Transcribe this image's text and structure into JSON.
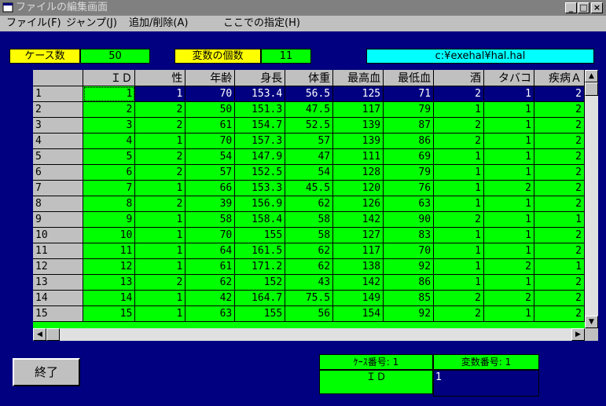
{
  "window": {
    "title": "ファイルの編集画面",
    "min_glyph": "_",
    "max_glyph": "□",
    "close_glyph": "×"
  },
  "menu": [
    "ファイル(F)",
    "ジャンプ(J)",
    "追加/削除(A)",
    "ここでの指定(H)"
  ],
  "info": {
    "case_count_label": "ケース数",
    "case_count_value": "50",
    "var_count_label": "変数の個数",
    "var_count_value": "11",
    "file_path": "c:¥exehal¥hal.hal"
  },
  "grid": {
    "columns": [
      "ＩＤ",
      "性",
      "年齢",
      "身長",
      "体重",
      "最高血",
      "最低血",
      "酒",
      "タバコ",
      "疾病Ａ"
    ],
    "rows": [
      {
        "n": "1",
        "cells": [
          "1",
          "1",
          "70",
          "153.4",
          "56.5",
          "125",
          "71",
          "2",
          "1",
          "2"
        ]
      },
      {
        "n": "2",
        "cells": [
          "2",
          "2",
          "50",
          "151.3",
          "47.5",
          "117",
          "79",
          "1",
          "1",
          "2"
        ]
      },
      {
        "n": "3",
        "cells": [
          "3",
          "2",
          "61",
          "154.7",
          "52.5",
          "139",
          "87",
          "2",
          "1",
          "2"
        ]
      },
      {
        "n": "4",
        "cells": [
          "4",
          "1",
          "70",
          "157.3",
          "57",
          "139",
          "86",
          "2",
          "1",
          "2"
        ]
      },
      {
        "n": "5",
        "cells": [
          "5",
          "2",
          "54",
          "147.9",
          "47",
          "111",
          "69",
          "1",
          "1",
          "2"
        ]
      },
      {
        "n": "6",
        "cells": [
          "6",
          "2",
          "57",
          "152.5",
          "54",
          "128",
          "79",
          "1",
          "1",
          "2"
        ]
      },
      {
        "n": "7",
        "cells": [
          "7",
          "1",
          "66",
          "153.3",
          "45.5",
          "120",
          "76",
          "1",
          "2",
          "2"
        ]
      },
      {
        "n": "8",
        "cells": [
          "8",
          "2",
          "39",
          "156.9",
          "62",
          "126",
          "63",
          "1",
          "1",
          "2"
        ]
      },
      {
        "n": "9",
        "cells": [
          "9",
          "1",
          "58",
          "158.4",
          "58",
          "142",
          "90",
          "2",
          "1",
          "1"
        ]
      },
      {
        "n": "10",
        "cells": [
          "10",
          "1",
          "70",
          "155",
          "58",
          "127",
          "83",
          "1",
          "1",
          "2"
        ]
      },
      {
        "n": "11",
        "cells": [
          "11",
          "1",
          "64",
          "161.5",
          "62",
          "117",
          "70",
          "1",
          "1",
          "2"
        ]
      },
      {
        "n": "12",
        "cells": [
          "12",
          "1",
          "61",
          "171.2",
          "62",
          "138",
          "92",
          "1",
          "2",
          "1"
        ]
      },
      {
        "n": "13",
        "cells": [
          "13",
          "2",
          "62",
          "152",
          "43",
          "142",
          "86",
          "1",
          "1",
          "2"
        ]
      },
      {
        "n": "14",
        "cells": [
          "14",
          "1",
          "42",
          "164.7",
          "75.5",
          "149",
          "85",
          "2",
          "2",
          "2"
        ]
      },
      {
        "n": "15",
        "cells": [
          "15",
          "1",
          "63",
          "155",
          "56",
          "154",
          "92",
          "2",
          "1",
          "2"
        ]
      }
    ]
  },
  "buttons": {
    "end": "終了"
  },
  "status": {
    "case_no_label": "ｹｰｽ番号: 1",
    "var_no_label": "変数番号: 1",
    "var_name": "ＩＤ",
    "value": "1"
  },
  "scroll": {
    "up": "▲",
    "down": "▼",
    "left": "◀",
    "right": "▶"
  },
  "colors": {
    "background": "#000080",
    "grid_cell": "#00ff00",
    "label_yellow": "#ffff00",
    "path_cyan": "#00ffff"
  }
}
